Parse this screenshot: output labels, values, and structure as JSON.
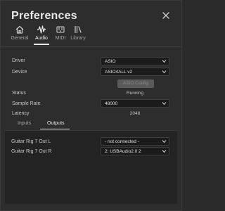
{
  "window": {
    "title": "Preferences"
  },
  "tabs": [
    {
      "label": "General",
      "icon": "home-icon"
    },
    {
      "label": "Audio",
      "icon": "audio-wave-icon"
    },
    {
      "label": "MIDI",
      "icon": "midi-icon"
    },
    {
      "label": "Library",
      "icon": "library-icon"
    }
  ],
  "active_tab": "Audio",
  "settings": {
    "driver": {
      "label": "Driver",
      "value": "ASIO"
    },
    "device": {
      "label": "Device",
      "value": "ASIO4ALL v2"
    },
    "asio_config_label": "ASIO Config",
    "status": {
      "label": "Status",
      "value": "Running"
    },
    "sample_rate": {
      "label": "Sample Rate",
      "value": "48000"
    },
    "latency": {
      "label": "Latency",
      "value": "2048"
    }
  },
  "io_tabs": [
    "Inputs",
    "Outputs"
  ],
  "active_io_tab": "Outputs",
  "outputs": [
    {
      "label": "Guitar Rig 7 Out L",
      "value": "- not connected -"
    },
    {
      "label": "Guitar Rig 7 Out R",
      "value": "2: USBAudio2.0 2"
    }
  ],
  "colors": {
    "background": "#2d2d2d",
    "panel": "#232323",
    "field": "#1b1b1b",
    "text": "#d2d2d2",
    "accent_underline": "#e8e8e8"
  }
}
